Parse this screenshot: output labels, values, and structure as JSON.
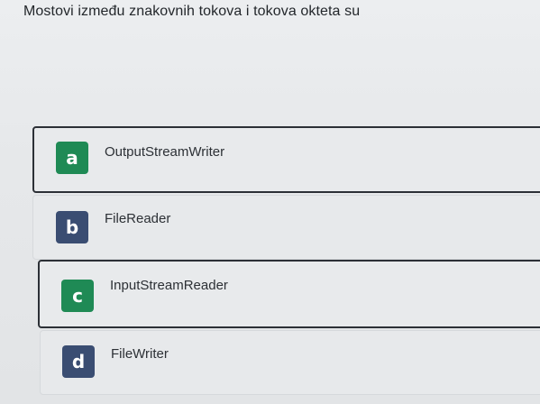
{
  "question": {
    "text": "Mostovi između znakovnih tokova i tokova okteta su"
  },
  "options": [
    {
      "letter": "a",
      "label": "OutputStreamWriter",
      "selected": true,
      "badge_color": "#1f8a55"
    },
    {
      "letter": "b",
      "label": "FileReader",
      "selected": false,
      "badge_color": "#3a4d72"
    },
    {
      "letter": "c",
      "label": "InputStreamReader",
      "selected": true,
      "badge_color": "#1f8a55"
    },
    {
      "letter": "d",
      "label": "FileWriter",
      "selected": false,
      "badge_color": "#3a4d72"
    }
  ]
}
